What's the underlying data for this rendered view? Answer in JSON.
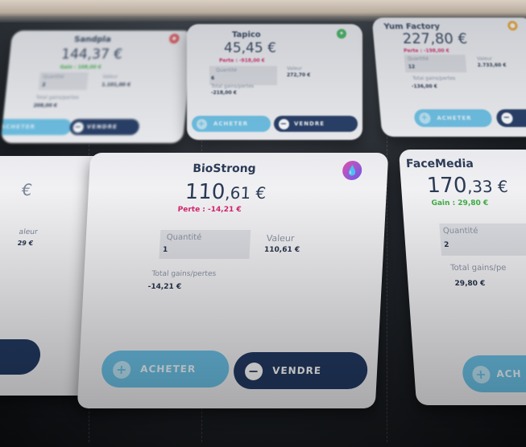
{
  "actions": {
    "buy_label": "ACHETER",
    "sell_label": "VENDRE",
    "plus_symbol": "+",
    "minus_symbol": "−"
  },
  "labels": {
    "quantity": "Quantité",
    "value": "Valeur",
    "total": "Total gains/pertes"
  },
  "cards": {
    "sandpla": {
      "name": "Sandpla",
      "price": "144,37 €",
      "delta": "Gain : 108,00 €",
      "quantity": "2",
      "value": "1.101,00 €",
      "total": "208,00 €",
      "badge_color": "#e0474c"
    },
    "tapico": {
      "name": "Tapico",
      "price": "45,45 €",
      "delta": "Perte : -918,00 €",
      "quantity": "6",
      "value": "272,70 €",
      "total": "-218,00 €",
      "badge_color": "#3fb35b"
    },
    "yumfactory": {
      "name": "Yum Factory",
      "price": "227,80 €",
      "delta": "Perte : -198,00 €",
      "quantity": "12",
      "value": "2.733,60 €",
      "total": "-136,00 €",
      "badge_color": "#f0a32a"
    },
    "left": {
      "price_fragment": "€",
      "value_label_fragment": "aleur",
      "value_fragment": "29 €",
      "badge_color": "#3a7be0"
    },
    "biostrong": {
      "name": "BioStrong",
      "price_main": "110",
      "price_cents": ",61 €",
      "delta": "Perte : -14,21 €",
      "quantity": "1",
      "value": "110,61 €",
      "total": "-14,21 €",
      "badge_color": "#9b4fe0"
    },
    "facemedia": {
      "name": "FaceMedia",
      "price_main": "170",
      "price_cents": ",33 €",
      "delta": "Gain : 29,80 €",
      "quantity": "2",
      "value_label_fragment": "Total gains/pe",
      "total": "29,80 €",
      "buy_fragment": "ACH"
    }
  }
}
